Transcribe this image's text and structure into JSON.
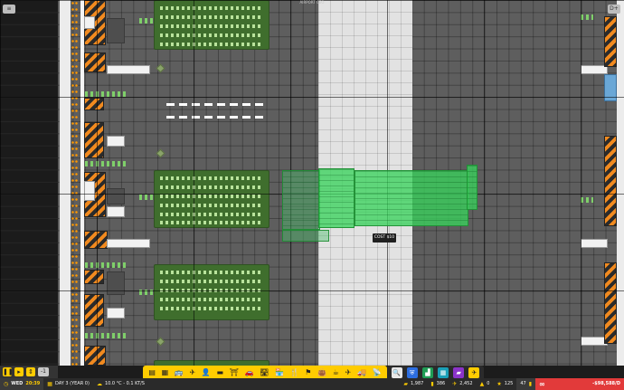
{
  "window": {
    "title": "AIRPORT CEO"
  },
  "placement": {
    "tooltip": "COST $10"
  },
  "corner": {
    "right_button": "D+"
  },
  "controls": {
    "speed_badge": "-1"
  },
  "toolbar": {
    "tools": [
      "zone-icon",
      "build-icon",
      "bus-icon",
      "runway-icon",
      "person-icon",
      "bed-icon",
      "gate-icon",
      "car-icon",
      "road-icon",
      "shop-icon",
      "food-icon",
      "flag-icon",
      "bag-icon",
      "coffee-icon",
      "plane-icon",
      "truck-icon",
      "atc-icon"
    ],
    "glyphs": [
      "▤",
      "▦",
      "🚌",
      "✈",
      "👤",
      "▬",
      "⛩",
      "🚗",
      "🛣",
      "🏪",
      "🍴",
      "⚑",
      "👜",
      "☕",
      "✈",
      "🚚",
      "📡"
    ]
  },
  "toolbar_right": {
    "tools": [
      {
        "name": "search-icon",
        "glyph": "🔍",
        "color": "#222222"
      },
      {
        "name": "shield-icon",
        "glyph": "⛨",
        "color": "#2d6ee0"
      },
      {
        "name": "stats-icon",
        "glyph": "▟",
        "color": "#1f9d55"
      },
      {
        "name": "layers-icon",
        "glyph": "▦",
        "color": "#1aa0b8"
      },
      {
        "name": "info-icon",
        "glyph": "▰",
        "color": "#8b33c9"
      },
      {
        "name": "plane-view-icon",
        "glyph": "✈",
        "color": "#ffcc00"
      }
    ]
  },
  "status": {
    "day": "WED",
    "time": "20:39",
    "date": "DAY 3 (YEAR 0)",
    "weather": "10.0 °C - 0.1 KT/S",
    "passengers": "1,987",
    "staff": "386",
    "flights": "2,452",
    "warnings": "0",
    "rating": "125",
    "level": "47",
    "infinite": "∞",
    "money": "-$98,588/D"
  },
  "colors": {
    "accent": "#ffcc00",
    "ghost": "#3ad25c",
    "money_bad": "#e23a3a"
  }
}
